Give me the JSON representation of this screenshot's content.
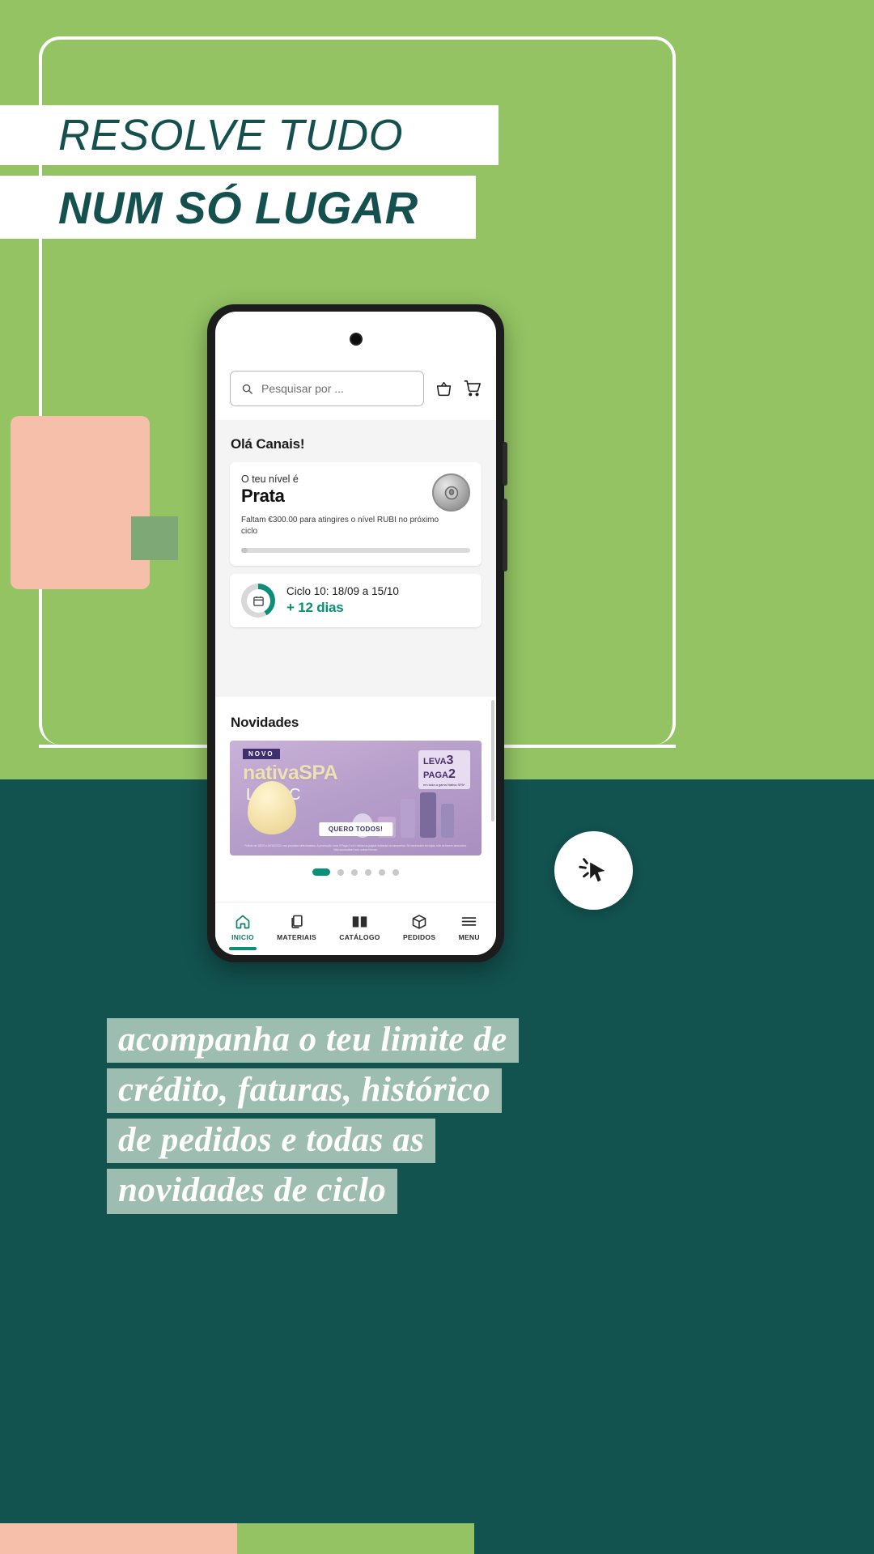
{
  "colors": {
    "green": "#93c363",
    "teal": "#12524f",
    "dark_teal_text": "#13504e",
    "peach": "#f6bfa9",
    "sage": "#7fa877",
    "app_accent": "#0b8f78",
    "muted_sage": "#9dbdb0"
  },
  "headline": {
    "line1": "RESOLVE TUDO",
    "line2": "NUM SÓ LUGAR"
  },
  "phone": {
    "search": {
      "placeholder": "Pesquisar por ...",
      "icon": "search-icon"
    },
    "header_icons": [
      {
        "name": "basket-icon"
      },
      {
        "name": "cart-icon"
      }
    ],
    "greeting": "Olá Canais!",
    "level_card": {
      "label": "O teu nível é",
      "level": "Prata",
      "description": "Faltam €300.00 para atingires o nível RUBI no próximo ciclo",
      "progress_percent": 3,
      "medal_icon": "medal-icon"
    },
    "cycle_card": {
      "title": "Ciclo 10: 18/09 a 15/10",
      "days": "+ 12 dias",
      "icon": "calendar-icon",
      "donut_percent": 42
    },
    "news": {
      "title": "Novidades",
      "banner": {
        "tag": "NOVO",
        "brand": "nativaSPA",
        "product": "LILAC",
        "offer_line1": "LEVA",
        "offer_num1": "3",
        "offer_line2": "PAGA",
        "offer_num2": "2",
        "offer_sub": "em toda a gama Nativa SPA*",
        "cta": "QUERO TODOS!",
        "legal": "*Válido de 18/09 a 15/10/2024, nos produtos selecionados. A promoção Leva 3 Paga 2 só é válida na página indicada na campanha. Se necessário em lojas, não se fazem descontos. Não acumulável com outras formas."
      },
      "dots_total": 6,
      "dots_active": 0
    },
    "bottom_nav": [
      {
        "label": "INICIO",
        "icon": "home-icon",
        "active": true
      },
      {
        "label": "MATERIAIS",
        "icon": "copy-icon",
        "active": false
      },
      {
        "label": "CATÁLOGO",
        "icon": "book-icon",
        "active": false
      },
      {
        "label": "PEDIDOS",
        "icon": "package-icon",
        "active": false
      },
      {
        "label": "MENU",
        "icon": "hamburger-icon",
        "active": false
      }
    ]
  },
  "cursor_badge": {
    "icon": "click-cursor-icon"
  },
  "bottom_text": {
    "lines": [
      "acompanha o teu limite de",
      "crédito, faturas, histórico",
      "de pedidos e todas as",
      "novidades de ciclo"
    ]
  }
}
